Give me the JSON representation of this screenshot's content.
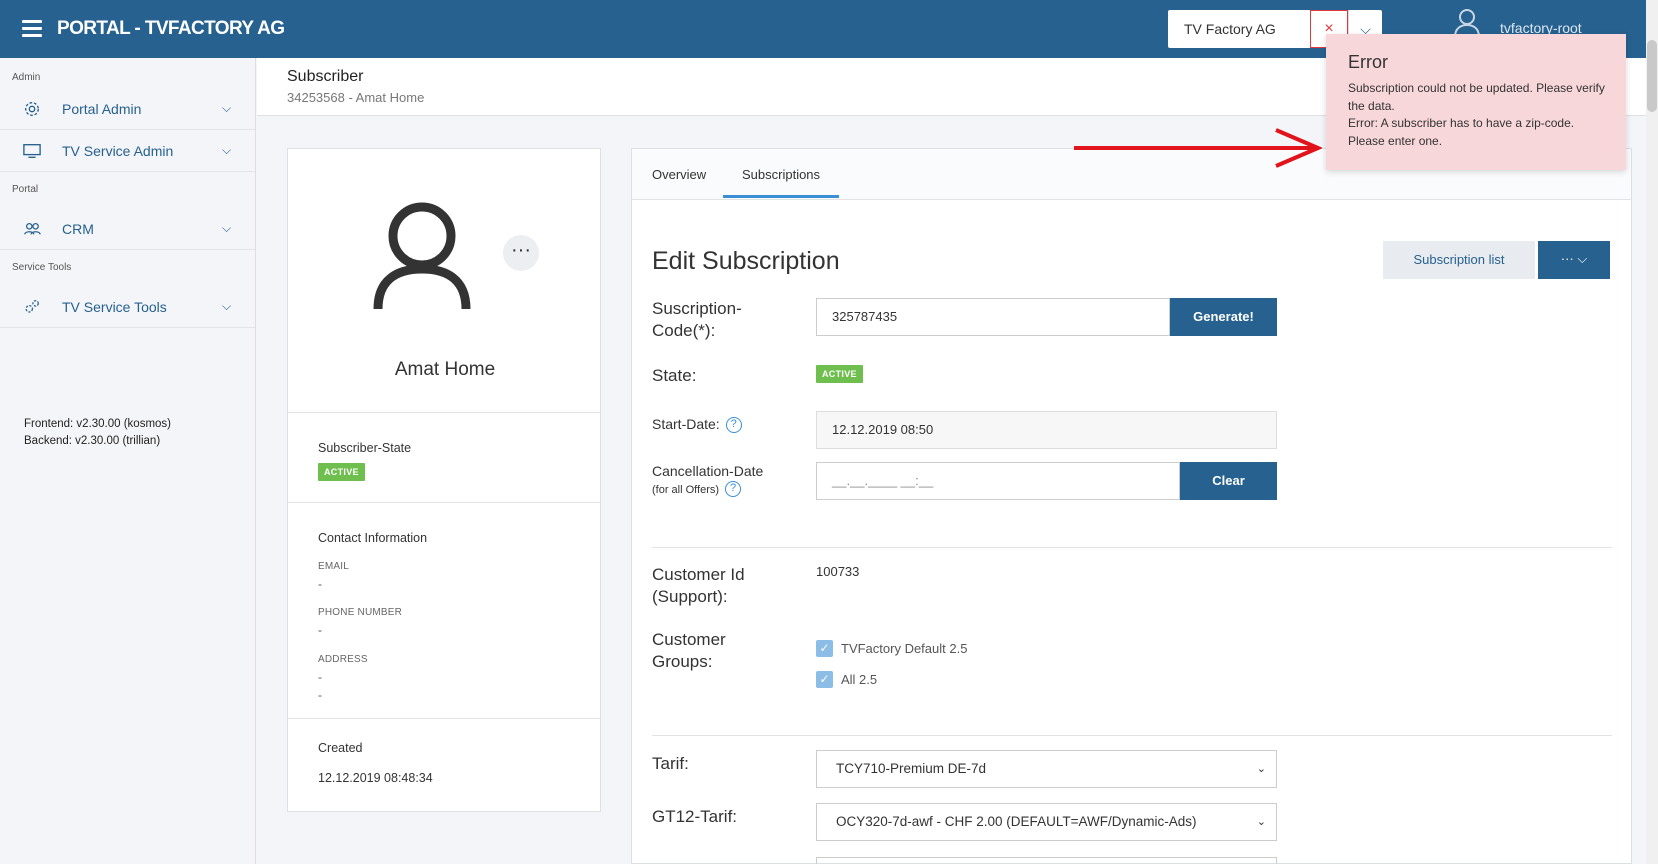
{
  "app": {
    "title": "PORTAL - TVFACTORY AG"
  },
  "tenant": {
    "value": "TV Factory AG",
    "clear": "×",
    "dropdown": "⌵"
  },
  "user": {
    "name": "tvfactory-root",
    "chevron": "⌵"
  },
  "sidebar": {
    "sections": [
      {
        "label": "Admin"
      },
      {
        "label": "Portal"
      },
      {
        "label": "Service Tools"
      }
    ],
    "items": [
      {
        "label": "Portal Admin",
        "icon": "gear-icon"
      },
      {
        "label": "TV Service Admin",
        "icon": "monitor-icon"
      },
      {
        "label": "CRM",
        "icon": "users-icon"
      },
      {
        "label": "TV Service Tools",
        "icon": "gears-icon"
      }
    ],
    "chevron": "⌵",
    "version": {
      "frontend": "Frontend: v2.30.00 (kosmos)",
      "backend": "Backend: v2.30.00 (trillian)"
    }
  },
  "page": {
    "title": "Subscriber",
    "subtitle": "34253568 - Amat Home"
  },
  "profile": {
    "name": "Amat Home",
    "more": "···",
    "state_label": "Subscriber-State",
    "state_badge": "ACTIVE",
    "contact_title": "Contact Information",
    "email_label": "EMAIL",
    "email_value": "-",
    "phone_label": "PHONE NUMBER",
    "phone_value": "-",
    "address_label": "ADDRESS",
    "address_value1": "-",
    "address_value2": "-",
    "created_label": "Created",
    "created_value": "12.12.2019 08:48:34"
  },
  "tabs": [
    {
      "label": "Overview"
    },
    {
      "label": "Subscriptions"
    }
  ],
  "edit": {
    "title": "Edit Subscription",
    "subscription_list_button": "Subscription list",
    "more_button": "··· ⌵",
    "code_label_1": "Suscription-",
    "code_label_2": "Code(*):",
    "code_value": "325787435",
    "generate_button": "Generate!",
    "state_label": "State:",
    "state_badge": "ACTIVE",
    "start_label": "Start-Date:",
    "start_value": "12.12.2019 08:50",
    "help": "?",
    "cancel_label": "Cancellation-Date",
    "cancel_sub": "(for all Offers)",
    "cancel_placeholder": "__.__.____ __:__",
    "clear_button": "Clear",
    "customer_id_label_1": "Customer Id",
    "customer_id_label_2": "(Support):",
    "customer_id_value": "100733",
    "groups_label_1": "Customer",
    "groups_label_2": "Groups:",
    "groups": [
      {
        "label": "TVFactory Default 2.5",
        "checked": true
      },
      {
        "label": "All 2.5",
        "checked": true
      }
    ],
    "tarif_label": "Tarif:",
    "tarif_value": "TCY710-Premium DE-7d",
    "gt12_label": "GT12-Tarif:",
    "gt12_value": "OCY320-7d-awf - CHF 2.00 (DEFAULT=AWF/Dynamic-Ads)",
    "select_caret": "⌄"
  },
  "toast": {
    "title": "Error",
    "line1": "Subscription could not be updated. Please verify the data.",
    "line2": "Error: A subscriber has to have a zip-code. Please enter one."
  },
  "colors": {
    "primary": "#26618f",
    "active_badge": "#6fbf4f",
    "error_bg": "#f8d7da",
    "annotation_arrow": "#e0141a"
  }
}
